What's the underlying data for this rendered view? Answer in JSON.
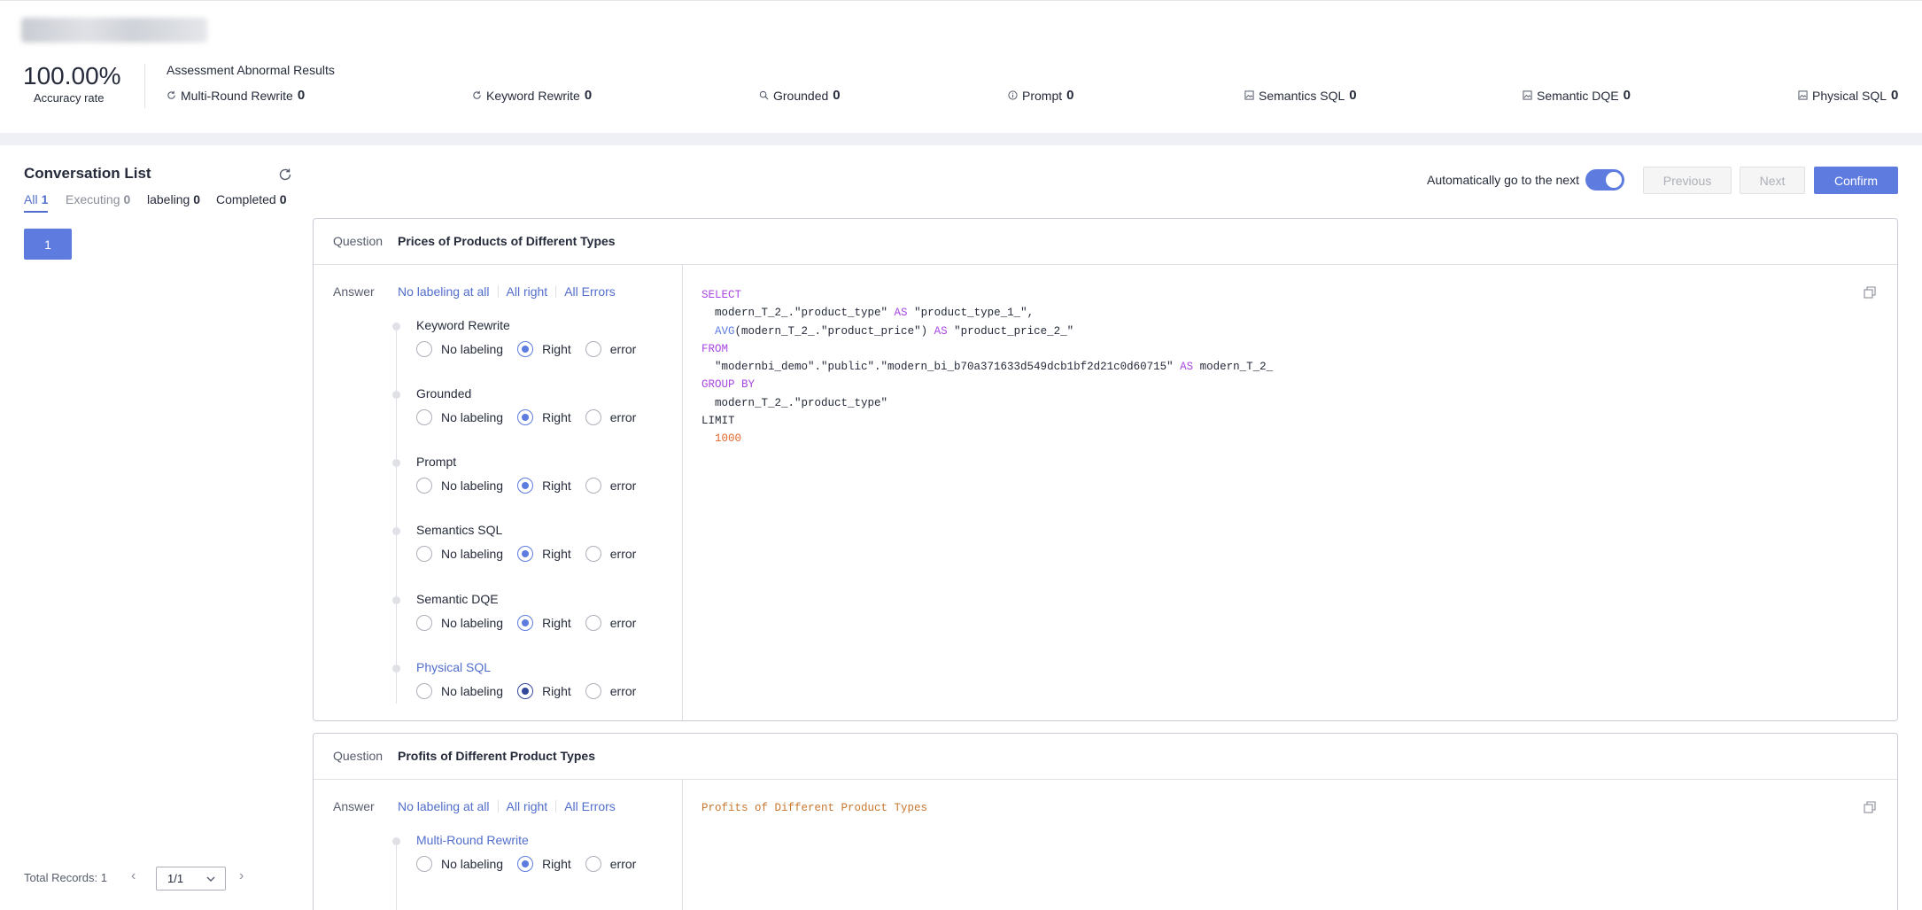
{
  "summary": {
    "accuracy_value": "100.00%",
    "accuracy_label": "Accuracy rate",
    "abnormal_title": "Assessment Abnormal Results",
    "metrics": [
      {
        "label": "Multi-Round Rewrite",
        "count": "0",
        "icon": "refresh-icon"
      },
      {
        "label": "Keyword Rewrite",
        "count": "0",
        "icon": "refresh-icon"
      },
      {
        "label": "Grounded",
        "count": "0",
        "icon": "search-icon"
      },
      {
        "label": "Prompt",
        "count": "0",
        "icon": "info-icon"
      },
      {
        "label": "Semantics SQL",
        "count": "0",
        "icon": "image-icon"
      },
      {
        "label": "Semantic DQE",
        "count": "0",
        "icon": "image-icon"
      },
      {
        "label": "Physical SQL",
        "count": "0",
        "icon": "image-icon"
      }
    ]
  },
  "conversation": {
    "title": "Conversation List",
    "tabs": [
      {
        "label": "All",
        "count": "1"
      },
      {
        "label": "Executing",
        "count": "0"
      },
      {
        "label": "labeling",
        "count": "0"
      },
      {
        "label": "Completed",
        "count": "0"
      }
    ],
    "items": [
      "1"
    ],
    "total_records": "Total Records: 1",
    "page": "1/1"
  },
  "toolbar": {
    "auto_next_label": "Automatically go to the next",
    "auto_next_on": true,
    "previous": "Previous",
    "next": "Next",
    "confirm": "Confirm"
  },
  "labels": {
    "question": "Question",
    "answer": "Answer",
    "no_labeling_all": "No labeling at all",
    "all_right": "All right",
    "all_errors": "All Errors",
    "opt_no": "No labeling",
    "opt_right": "Right",
    "opt_error": "error"
  },
  "questions": [
    {
      "question": "Prices of Products of Different Types",
      "groups": [
        "Keyword Rewrite",
        "Grounded",
        "Prompt",
        "Semantics SQL",
        "Semantic DQE",
        "Physical SQL"
      ],
      "selected": "Right",
      "sql": {
        "l1": "SELECT",
        "l2a": "  modern_T_2_.\"product_type\" ",
        "l2b": "AS",
        "l2c": " \"product_type_1_\",",
        "l3a": "  ",
        "l3b": "AVG",
        "l3c": "(modern_T_2_.\"product_price\") ",
        "l3d": "AS",
        "l3e": " \"product_price_2_\"",
        "l4": "FROM",
        "l5a": "  \"modernbi_demo\".\"public\".\"modern_bi_b70a371633d549dcb1bf2d21c0d60715\" ",
        "l5b": "AS",
        "l5c": " modern_T_2_",
        "l6": "GROUP BY",
        "l7": "  modern_T_2_.\"product_type\"",
        "l8": "LIMIT",
        "l9": "1000"
      }
    },
    {
      "question": "Profits of Different Product Types",
      "groups": [
        "Multi-Round Rewrite"
      ],
      "selected": "Right",
      "text": "Profits of Different Product Types"
    }
  ],
  "colors": {
    "accent": "#5e7ce0",
    "link": "#526ecc",
    "keyword": "#a846e0",
    "number": "#e0662c"
  }
}
